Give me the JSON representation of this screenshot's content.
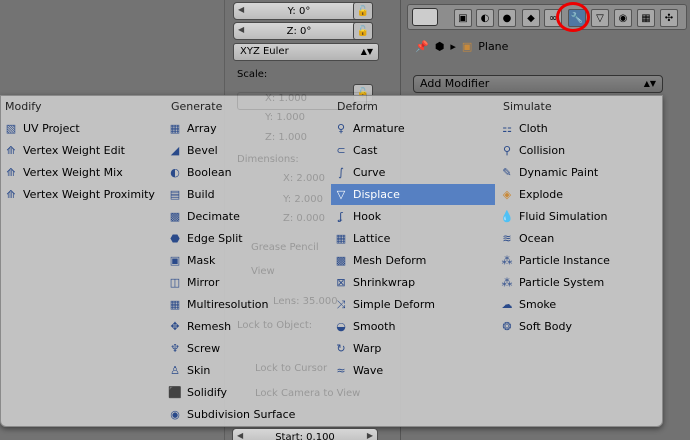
{
  "npanel": {
    "rot_y": "Y: 0°",
    "rot_z": "Z: 0°",
    "rotation_mode": "XYZ Euler",
    "scale_label": "Scale:",
    "scale_x": "X: 1.000",
    "scale_y": "Y: 1.000",
    "scale_z": "Z: 1.000",
    "dimensions_label": "Dimensions:",
    "dim_x": "X: 2.000",
    "dim_y": "Y: 2.000",
    "dim_z": "Z: 0.000",
    "grease_pencil": "Grease Pencil",
    "view": "View",
    "lens": "Lens: 35.000",
    "lock_to_object": "Lock to Object:",
    "lock_to_cursor": "Lock to Cursor",
    "lock_camera": "Lock Camera to View",
    "clip_start": "Start: 0.100"
  },
  "properties": {
    "object_name": "Plane",
    "add_modifier": "Add Modifier"
  },
  "menu": {
    "modify": {
      "heading": "Modify",
      "items": [
        "UV Project",
        "Vertex Weight Edit",
        "Vertex Weight Mix",
        "Vertex Weight Proximity"
      ]
    },
    "generate": {
      "heading": "Generate",
      "items": [
        "Array",
        "Bevel",
        "Boolean",
        "Build",
        "Decimate",
        "Edge Split",
        "Mask",
        "Mirror",
        "Multiresolution",
        "Remesh",
        "Screw",
        "Skin",
        "Solidify",
        "Subdivision Surface"
      ]
    },
    "deform": {
      "heading": "Deform",
      "items": [
        "Armature",
        "Cast",
        "Curve",
        "Displace",
        "Hook",
        "Lattice",
        "Mesh Deform",
        "Shrinkwrap",
        "Simple Deform",
        "Smooth",
        "Warp",
        "Wave"
      ]
    },
    "simulate": {
      "heading": "Simulate",
      "items": [
        "Cloth",
        "Collision",
        "Dynamic Paint",
        "Explode",
        "Fluid Simulation",
        "Ocean",
        "Particle Instance",
        "Particle System",
        "Smoke",
        "Soft Body"
      ]
    },
    "selected_item": "Displace"
  },
  "colors": {
    "highlight": "#5680c2",
    "annotation_circle": "#e00000"
  }
}
